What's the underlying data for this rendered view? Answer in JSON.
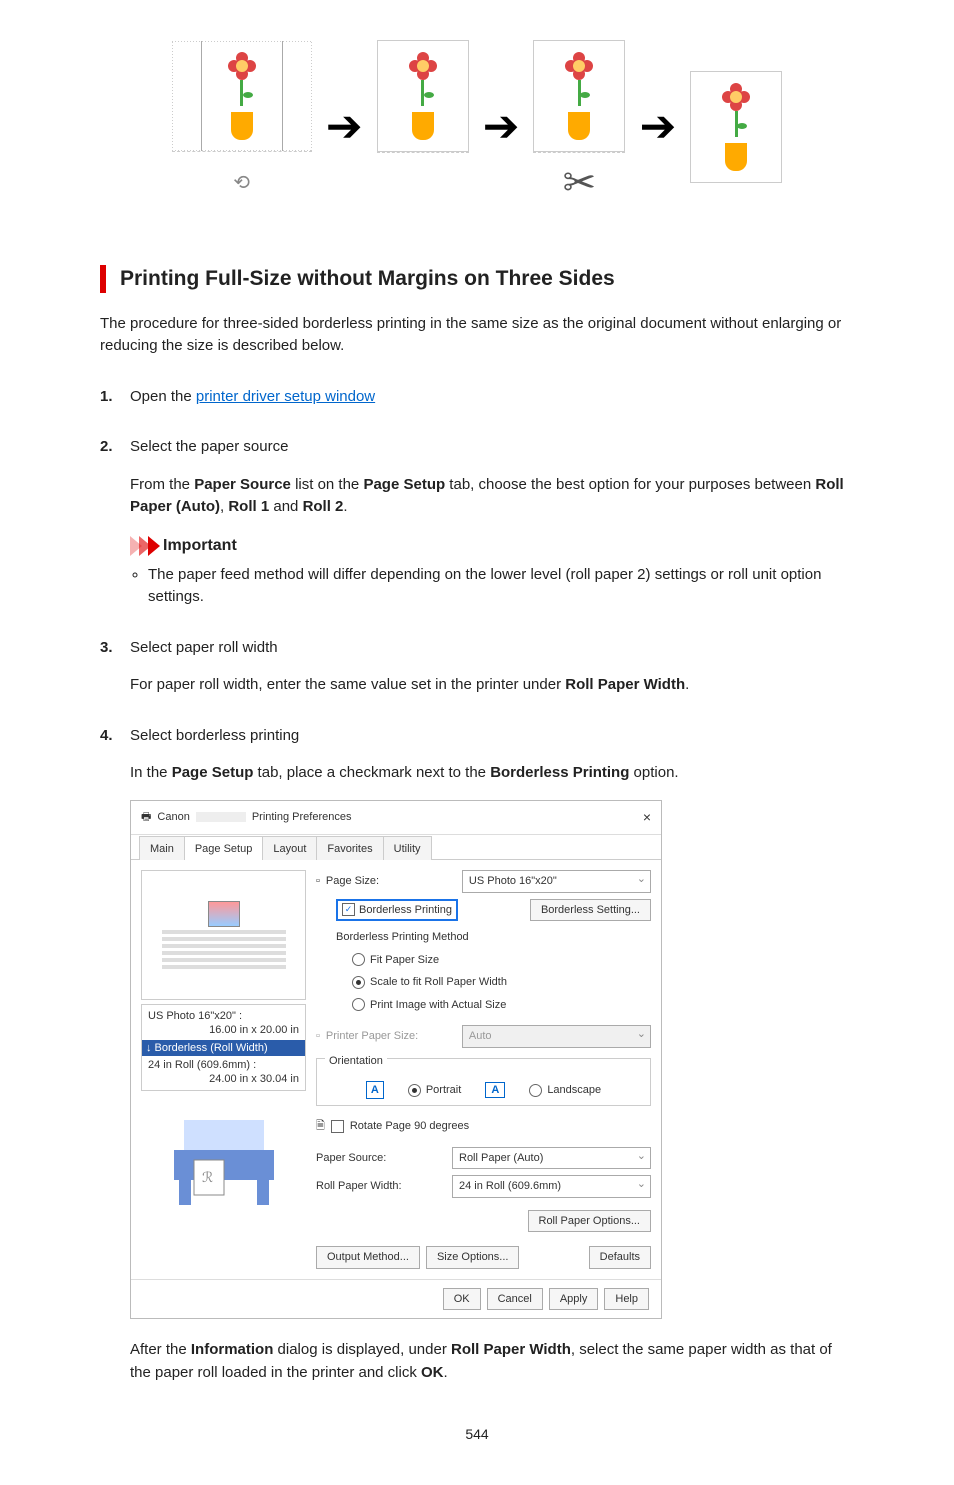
{
  "heading": "Printing Full-Size without Margins on Three Sides",
  "intro": "The procedure for three-sided borderless printing in the same size as the original document without enlarging or reducing the size is described below.",
  "steps": {
    "s1": {
      "num": "1.",
      "lead": "Open the ",
      "link": "printer driver setup window"
    },
    "s2": {
      "num": "2.",
      "title": "Select the paper source",
      "body_pre": "From the ",
      "b1": "Paper Source",
      "mid1": " list on the ",
      "b2": "Page Setup",
      "mid2": " tab, choose the best option for your purposes between ",
      "b3": "Roll Paper (Auto)",
      "sep1": ", ",
      "b4": "Roll 1",
      "sep2": " and ",
      "b5": "Roll 2",
      "end": "."
    },
    "s3": {
      "num": "3.",
      "title": "Select paper roll width",
      "body_pre": "For paper roll width, enter the same value set in the printer under ",
      "b1": "Roll Paper Width",
      "end": "."
    },
    "s4": {
      "num": "4.",
      "title": "Select borderless printing",
      "body_pre": "In the ",
      "b1": "Page Setup",
      "mid1": " tab, place a checkmark next to the ",
      "b2": "Borderless Printing",
      "end": " option.",
      "after_pre": "After the ",
      "ab1": "Information",
      "amid1": " dialog is displayed, under ",
      "ab2": "Roll Paper Width",
      "amid2": ", select the same paper width as that of the paper roll loaded in the printer and click ",
      "ab3": "OK",
      "aend": "."
    }
  },
  "important": {
    "label": "Important",
    "bullet": "The paper feed method will differ depending on the lower level (roll paper 2) settings or roll unit option settings."
  },
  "dialog": {
    "title_prefix": "Canon",
    "title_suffix": "Printing Preferences",
    "close": "×",
    "tabs": {
      "main": "Main",
      "page_setup": "Page Setup",
      "layout": "Layout",
      "favorites": "Favorites",
      "utility": "Utility"
    },
    "left": {
      "info1_label": "US Photo 16\"x20\" :",
      "info1_dim": "16.00 in x 20.00 in",
      "info1_blue": "↓  Borderless (Roll Width)",
      "info2_label": "24 in Roll (609.6mm) :",
      "info2_dim": "24.00 in x 30.04 in"
    },
    "right": {
      "page_size_label": "Page Size:",
      "page_size_value": "US Photo 16\"x20\"",
      "borderless_chk": "Borderless Printing",
      "borderless_btn": "Borderless Setting...",
      "method_title": "Borderless Printing Method",
      "m1": "Fit Paper Size",
      "m2": "Scale to fit Roll Paper Width",
      "m3": "Print Image with Actual Size",
      "printer_paper_label": "Printer Paper Size:",
      "printer_paper_value": "Auto",
      "orientation_title": "Orientation",
      "portrait": "Portrait",
      "landscape": "Landscape",
      "rotate": "Rotate Page 90 degrees",
      "paper_source_label": "Paper Source:",
      "paper_source_value": "Roll Paper (Auto)",
      "roll_width_label": "Roll Paper Width:",
      "roll_width_value": "24 in Roll (609.6mm)",
      "roll_options": "Roll Paper Options...",
      "output_method": "Output Method...",
      "size_options": "Size Options...",
      "defaults": "Defaults"
    },
    "footer": {
      "ok": "OK",
      "cancel": "Cancel",
      "apply": "Apply",
      "help": "Help"
    }
  },
  "page_number": "544"
}
